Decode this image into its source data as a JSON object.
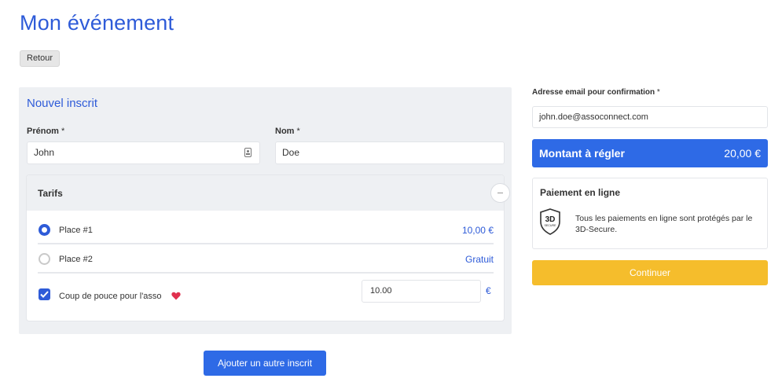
{
  "page": {
    "title": "Mon événement",
    "back_label": "Retour"
  },
  "form": {
    "title": "Nouvel inscrit",
    "firstname": {
      "label": "Prénom",
      "required_mark": " *",
      "value": "John"
    },
    "lastname": {
      "label": "Nom",
      "required_mark": " *",
      "value": "Doe"
    },
    "tarifs": {
      "title": "Tarifs",
      "options": [
        {
          "label": "Place #1",
          "price": "10,00 €",
          "selected": true
        },
        {
          "label": "Place #2",
          "price": "Gratuit",
          "selected": false
        }
      ],
      "tip": {
        "label": "Coup de pouce pour l'asso",
        "checked": true,
        "value": "10.00",
        "currency": "€"
      }
    },
    "add_button_label": "Ajouter un autre inscrit"
  },
  "summary": {
    "email": {
      "label": "Adresse email pour confirmation",
      "required_mark": " *",
      "value": "john.doe@assoconnect.com"
    },
    "amount": {
      "label": "Montant à régler",
      "value": "20,00 €"
    },
    "payment": {
      "title": "Paiement en ligne",
      "badge": {
        "line1": "3D",
        "line2": "SECURE"
      },
      "text": "Tous les paiements en ligne sont protégés par le 3D-Secure."
    },
    "continue_label": "Continuer"
  },
  "colors": {
    "accent": "#2e5bd8",
    "button_blue": "#2e6ae6",
    "continue_yellow": "#f5bd2c",
    "heart": "#e0304e"
  }
}
